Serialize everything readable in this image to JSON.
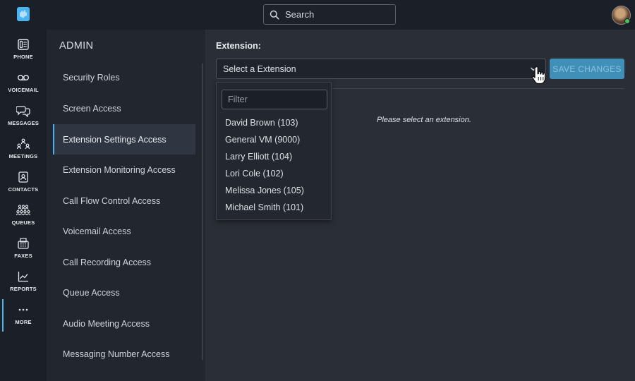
{
  "top": {
    "search_label": "Search"
  },
  "rail": {
    "items": [
      {
        "label": "PHONE",
        "icon": "phone-icon"
      },
      {
        "label": "VOICEMAIL",
        "icon": "voicemail-icon"
      },
      {
        "label": "MESSAGES",
        "icon": "messages-icon"
      },
      {
        "label": "MEETINGS",
        "icon": "meetings-icon"
      },
      {
        "label": "CONTACTS",
        "icon": "contacts-icon"
      },
      {
        "label": "QUEUES",
        "icon": "queues-icon"
      },
      {
        "label": "FAXES",
        "icon": "fax-icon"
      },
      {
        "label": "REPORTS",
        "icon": "reports-icon"
      },
      {
        "label": "MORE",
        "icon": "more-icon",
        "active": true
      }
    ]
  },
  "admin": {
    "title": "ADMIN",
    "items": [
      {
        "label": "Security Roles"
      },
      {
        "label": "Screen Access"
      },
      {
        "label": "Extension Settings Access",
        "active": true
      },
      {
        "label": "Extension Monitoring Access"
      },
      {
        "label": "Call Flow Control Access"
      },
      {
        "label": "Voicemail Access"
      },
      {
        "label": "Call Recording Access"
      },
      {
        "label": "Queue Access"
      },
      {
        "label": "Audio Meeting Access"
      },
      {
        "label": "Messaging Number Access"
      }
    ]
  },
  "main": {
    "extension_label": "Extension:",
    "select_placeholder": "Select a Extension",
    "save_label": "SAVE CHANGES",
    "empty_message": "Please select an extension."
  },
  "dropdown": {
    "filter_placeholder": "Filter",
    "options": [
      "David Brown (103)",
      "General VM (9000)",
      "Larry Elliott (104)",
      "Lori Cole (102)",
      "Melissa Jones (105)",
      "Michael Smith (101)"
    ]
  },
  "colors": {
    "accent": "#4ab3f0",
    "save_button": "#3f8fb8",
    "presence": "#4fc35a"
  }
}
